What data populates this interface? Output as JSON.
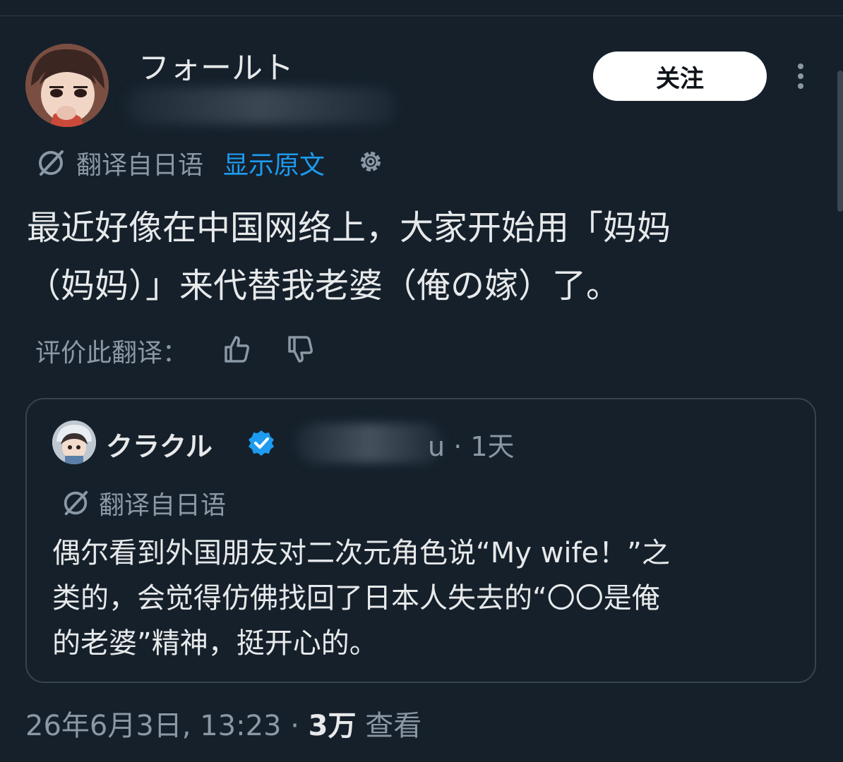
{
  "author": {
    "display_name": "フォールト"
  },
  "header": {
    "follow_label": "关注"
  },
  "translation": {
    "label": "翻译自日语",
    "show_original_label": "显示原文"
  },
  "tweet": {
    "text_line1": "最近好像在中国网络上，大家开始用「妈妈",
    "text_line2": "（妈妈）」来代替我老婆（俺の嫁）了。"
  },
  "rating": {
    "label": "评价此翻译："
  },
  "quote": {
    "name": "クラクル",
    "handle_suffix": "u",
    "time": "· 1天",
    "translation_label": "翻译自日语",
    "text_line1": "偶尔看到外国朋友对二次元角色说“My wife！”之",
    "text_line2": "类的，会觉得仿佛找回了日本人失去的“〇〇是俺",
    "text_line3": "的老婆”精神，挺开心的。"
  },
  "meta": {
    "datetime": "26年6月3日, 13:23 · ",
    "views_count": "3万",
    "views_label": "查看"
  },
  "colors": {
    "background": "#15202b",
    "text_primary": "#e7e9ea",
    "text_secondary": "#8b98a5",
    "accent": "#1d9bf0",
    "border": "#38444d"
  }
}
